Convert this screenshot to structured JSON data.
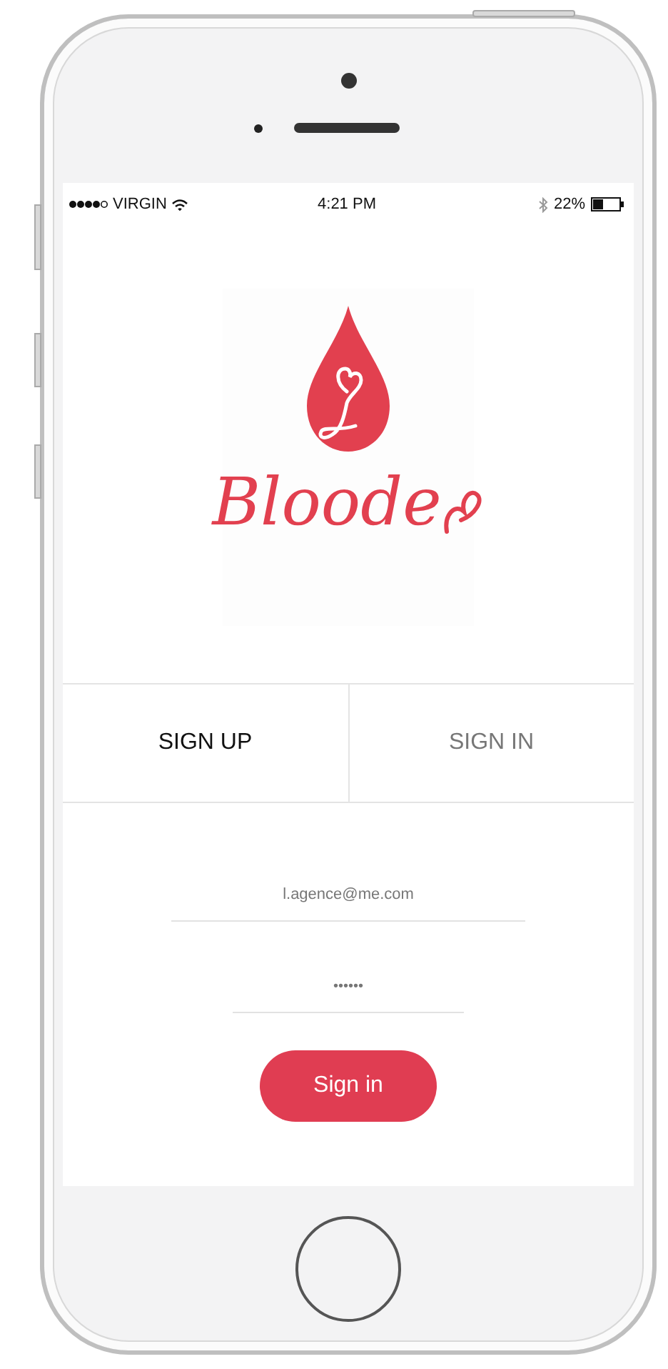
{
  "status_bar": {
    "carrier": "VIRGIN",
    "time": "4:21 PM",
    "battery": "22%"
  },
  "logo": {
    "wordmark": "Bloode"
  },
  "tabs": [
    {
      "label": "SIGN UP",
      "selected": true
    },
    {
      "label": "SIGN IN",
      "selected": false
    }
  ],
  "form": {
    "email": {
      "value": "l.agence@me.com"
    },
    "password": {
      "value": "••••••"
    },
    "submit": "Sign in"
  }
}
